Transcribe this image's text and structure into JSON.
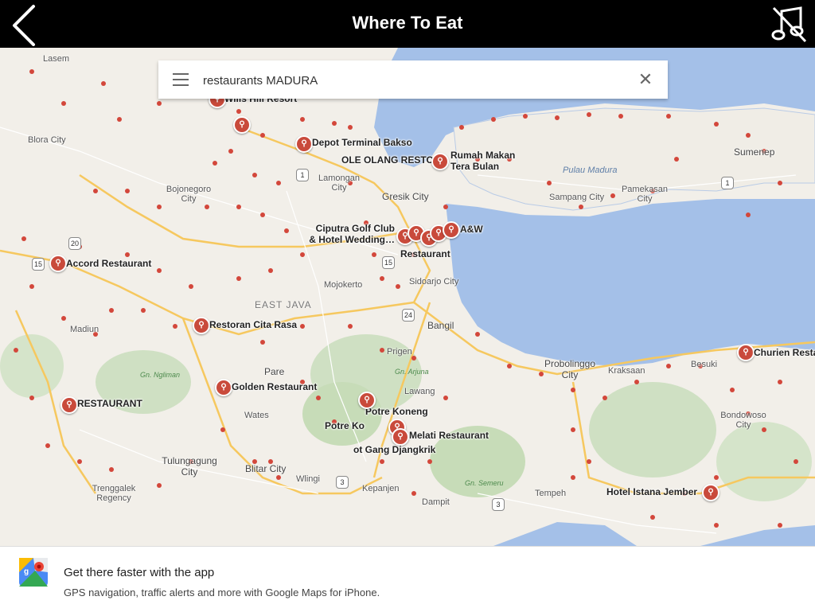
{
  "header": {
    "title": "Where To Eat",
    "back_icon": "chevron-left-icon",
    "sound_icon": "music-mute-icon"
  },
  "search": {
    "value": "restaurants MADURA",
    "menu_icon": "hamburger-menu-icon",
    "clear_icon": "close-icon"
  },
  "map": {
    "places": [
      "Lasem",
      "Blora City",
      "Bojonegoro City",
      "Lamongan City",
      "Gresik City",
      "Pulau Madura",
      "Sampang City",
      "Pamekasan City",
      "Sumenep",
      "Mojokerto",
      "EAST JAVA",
      "Sidoarjo City",
      "Madiun",
      "Bangil",
      "Prigen",
      "Gn. Ngliman",
      "Gn. Arjuna",
      "Lawang",
      "Pare",
      "Wates",
      "Probolinggo City",
      "Kraksaan",
      "Besuki",
      "Bondowoso City",
      "Gn. Semeru",
      "Tulungagung City",
      "Blitar City",
      "Wlingi",
      "Kepanjen",
      "Dampit",
      "Tempeh",
      "Trenggalek Regency"
    ],
    "restaurants": [
      "Wills Hill Resort",
      "Depot Terminal Bakso",
      "OLE OLANG RESTO",
      "Rumah Makan Tera Bulan",
      "Ciputra Golf Club & Hotel Wedding…",
      "A&W",
      "Restaurant",
      "Accord Restaurant",
      "Restoran Cita Rasa",
      "Golden Restaurant",
      "RESTAURANT",
      "Potre Koneng",
      "Potre Ko",
      "Melati Restaurant",
      "ot Gang Djangkrik",
      "Hotel Istana Jember",
      "Churien Resta"
    ],
    "route_shields": [
      "20",
      "15",
      "1",
      "15",
      "24",
      "3",
      "3",
      "1"
    ]
  },
  "banner": {
    "headline": "Get there faster with the app",
    "subtext": "GPS navigation, traffic alerts and more with Google Maps for iPhone.",
    "logo_icon": "google-maps-logo-icon"
  }
}
